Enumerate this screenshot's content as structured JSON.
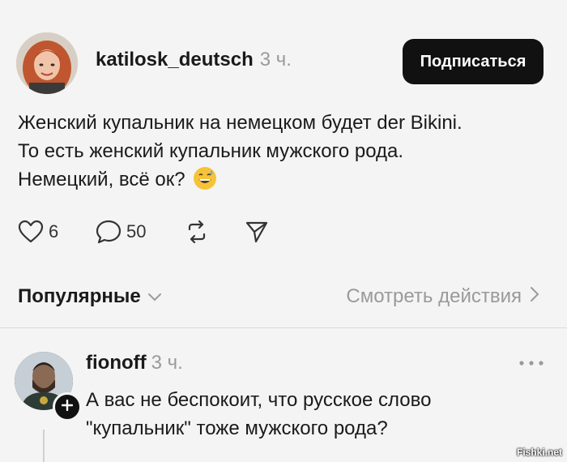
{
  "post": {
    "author": "katilosk_deutsch",
    "time": "3 ч.",
    "follow_label": "Подписаться",
    "text_lines": [
      "Женский купальник на немецком будет der Bikini.",
      "То есть женский купальник мужского рода.",
      "Немецкий, всё ок?"
    ],
    "emoji": "grinning-sweat-emoji",
    "likes": "6",
    "comments": "50"
  },
  "icons": {
    "like": "heart-icon",
    "comment": "speech-bubble-icon",
    "repost": "repost-icon",
    "share": "send-icon",
    "more": "more-icon",
    "plus": "plus-icon"
  },
  "sort": {
    "label": "Популярные",
    "activity_link": "Смотреть действия"
  },
  "reply": {
    "author": "fionoff",
    "time": "3 ч.",
    "text_lines": [
      "А вас не беспокоит, что русское слово",
      "\"купальник\" тоже мужского рода?"
    ]
  },
  "watermark": "Fishki.net",
  "colors": {
    "background": "#f4f4f4",
    "button": "#111111",
    "muted": "#9a9a9a"
  }
}
